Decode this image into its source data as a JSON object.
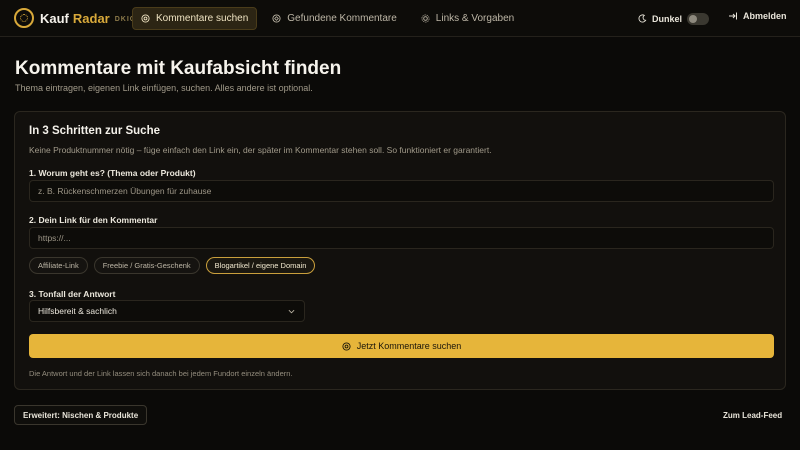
{
  "brand": {
    "name_part1": "Kauf",
    "name_part2": "Radar",
    "tag": "DKIG"
  },
  "nav": {
    "items": [
      {
        "label": "Kommentare suchen",
        "icon": "search-circle-icon",
        "active": true
      },
      {
        "label": "Gefundene Kommentare",
        "icon": "comments-icon",
        "active": false
      },
      {
        "label": "Links & Vorgaben",
        "icon": "gear-icon",
        "active": false
      }
    ],
    "theme_label": "Dunkel",
    "logout_label": "Abmelden"
  },
  "page": {
    "title": "Kommentare mit Kaufabsicht finden",
    "subtitle": "Thema eintragen, eigenen Link einfügen, suchen. Alles andere ist optional."
  },
  "card": {
    "title": "In 3 Schritten zur Suche",
    "description": "Keine Produktnummer nötig – füge einfach den Link ein, der später im Kommentar stehen soll. So funktioniert er garantiert.",
    "step1": {
      "label": "1. Worum geht es? (Thema oder Produkt)",
      "placeholder": "z. B. Rückenschmerzen Übungen für zuhause"
    },
    "step2": {
      "label": "2. Dein Link für den Kommentar",
      "placeholder": "https://...",
      "chips": [
        {
          "label": "Affiliate-Link",
          "active": false
        },
        {
          "label": "Freebie / Gratis-Geschenk",
          "active": false
        },
        {
          "label": "Blogartikel / eigene Domain",
          "active": true
        }
      ]
    },
    "step3": {
      "label": "3. Tonfall der Antwort",
      "selected": "Hilfsbereit & sachlich"
    },
    "cta_label": "Jetzt Kommentare suchen",
    "footnote": "Die Antwort und der Link lassen sich danach bei jedem Fundort einzeln ändern."
  },
  "footer": {
    "advanced_label": "Erweitert: Nischen & Produkte",
    "lead_feed_label": "Zum Lead-Feed"
  },
  "colors": {
    "accent": "#e6b53a",
    "background": "#0b0a08",
    "card": "#12100d"
  }
}
